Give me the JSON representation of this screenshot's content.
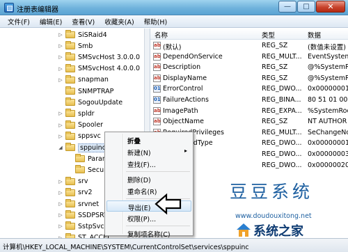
{
  "window": {
    "title": "注册表编辑器"
  },
  "menu": [
    "文件(F)",
    "编辑(E)",
    "查看(V)",
    "收藏夹(A)",
    "帮助(H)"
  ],
  "tree": [
    {
      "label": "SiSRaid4",
      "expand": "▷",
      "indent": 0
    },
    {
      "label": "Smb",
      "expand": "▷",
      "indent": 0
    },
    {
      "label": "SMSvcHost 3.0.0.0",
      "expand": "▷",
      "indent": 0
    },
    {
      "label": "SMSvcHost 4.0.0.0",
      "expand": "▷",
      "indent": 0
    },
    {
      "label": "snapman",
      "expand": "▷",
      "indent": 0
    },
    {
      "label": "SNMPTRAP",
      "expand": "",
      "indent": 0
    },
    {
      "label": "SogouUpdate",
      "expand": "",
      "indent": 0
    },
    {
      "label": "spldr",
      "expand": "▷",
      "indent": 0
    },
    {
      "label": "Spooler",
      "expand": "▷",
      "indent": 0
    },
    {
      "label": "sppsvc",
      "expand": "▷",
      "indent": 0
    },
    {
      "label": "sppuinotify",
      "expand": "◢",
      "indent": 0,
      "selected": true
    },
    {
      "label": "Parame",
      "expand": "",
      "indent": 1
    },
    {
      "label": "Security",
      "expand": "",
      "indent": 1
    },
    {
      "label": "srv",
      "expand": "▷",
      "indent": 0
    },
    {
      "label": "srv2",
      "expand": "▷",
      "indent": 0
    },
    {
      "label": "srvnet",
      "expand": "▷",
      "indent": 0
    },
    {
      "label": "SSDPSRV",
      "expand": "▷",
      "indent": 0
    },
    {
      "label": "SstpSvc",
      "expand": "▷",
      "indent": 0
    },
    {
      "label": "ST_ACCEL",
      "expand": "▷",
      "indent": 0
    },
    {
      "label": "stexstor",
      "expand": "▷",
      "indent": 0
    }
  ],
  "list": {
    "headers": {
      "name": "名称",
      "type": "类型",
      "data": "数据"
    },
    "rows": [
      {
        "icon": "ab",
        "kind": "str",
        "name": "(默认)",
        "type": "REG_SZ",
        "data": "(数值未设置)"
      },
      {
        "icon": "ab",
        "kind": "str",
        "name": "DependOnService",
        "type": "REG_MULT...",
        "data": "EventSystem"
      },
      {
        "icon": "ab",
        "kind": "str",
        "name": "Description",
        "type": "REG_SZ",
        "data": "@%SystemRoo"
      },
      {
        "icon": "ab",
        "kind": "str",
        "name": "DisplayName",
        "type": "REG_SZ",
        "data": "@%SystemRo"
      },
      {
        "icon": "01",
        "kind": "bin",
        "name": "ErrorControl",
        "type": "REG_DWO...",
        "data": "0x00000001"
      },
      {
        "icon": "01",
        "kind": "bin",
        "name": "FailureActions",
        "type": "REG_BINA...",
        "data": "80 51 01 00"
      },
      {
        "icon": "ab",
        "kind": "str",
        "name": "ImagePath",
        "type": "REG_EXPA...",
        "data": "%SystemRoo"
      },
      {
        "icon": "ab",
        "kind": "str",
        "name": "ObjectName",
        "type": "REG_SZ",
        "data": "NT AUTHOR"
      },
      {
        "icon": "ab",
        "kind": "str",
        "name": "RequiredPrivileges",
        "type": "REG_MULT...",
        "data": "SeChangeNo"
      },
      {
        "icon": "01",
        "kind": "bin",
        "name": "ServiceSidType",
        "type": "REG_DWO...",
        "data": "0x00000001"
      },
      {
        "icon": "01",
        "kind": "bin",
        "name": "",
        "type": "REG_DWO...",
        "data": "0x00000003"
      },
      {
        "icon": "01",
        "kind": "bin",
        "name": "",
        "type": "REG_DWO...",
        "data": "0x00000020"
      }
    ]
  },
  "context_menu": {
    "items": [
      {
        "label": "折叠",
        "bold": true
      },
      {
        "label": "新建(N)",
        "submenu": "▸"
      },
      {
        "label": "查找(F)..."
      },
      {
        "sep": true
      },
      {
        "label": "删除(D)"
      },
      {
        "label": "重命名(R)"
      },
      {
        "sep": true
      },
      {
        "label": "导出(E)",
        "highlighted": true
      },
      {
        "label": "权限(P)..."
      },
      {
        "sep": true
      },
      {
        "label": "复制项名称(C)"
      }
    ]
  },
  "status": {
    "path": "计算机\\HKEY_LOCAL_MACHINE\\SYSTEM\\CurrentControlSet\\services\\sppuinc"
  },
  "watermark": {
    "title": "豆豆系统",
    "url": "www.doudouxitong.net",
    "brand": "系统之家",
    "brand_color": "#0f3c73"
  }
}
